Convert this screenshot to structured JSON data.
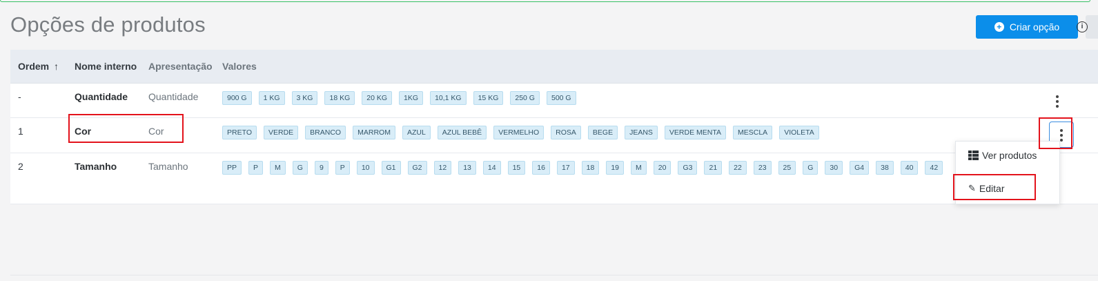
{
  "page": {
    "title": "Opções de produtos",
    "create_button": "Criar opção",
    "info_icon": "info-icon"
  },
  "table": {
    "columns": [
      "Ordem",
      "Nome interno",
      "Apresentação",
      "Valores"
    ],
    "sort_icon": "arrow-up-icon",
    "rows": [
      {
        "order": "-",
        "internal_name": "Quantidade",
        "presentation": "Quantidade",
        "values": [
          "900 G",
          "1 KG",
          "3 KG",
          "18 KG",
          "20 KG",
          "1KG",
          "10,1 KG",
          "15 KG",
          "250 G",
          "500 G"
        ]
      },
      {
        "order": "1",
        "internal_name": "Cor",
        "presentation": "Cor",
        "values": [
          "PRETO",
          "VERDE",
          "BRANCO",
          "MARROM",
          "AZUL",
          "AZUL BEBÊ",
          "VERMELHO",
          "ROSA",
          "BEGE",
          "JEANS",
          "VERDE MENTA",
          "MESCLA",
          "VIOLETA"
        ]
      },
      {
        "order": "2",
        "internal_name": "Tamanho",
        "presentation": "Tamanho",
        "values": [
          "PP",
          "P",
          "M",
          "G",
          "9",
          "P",
          "10",
          "G1",
          "G2",
          "12",
          "13",
          "14",
          "15",
          "16",
          "17",
          "18",
          "19",
          "M",
          "20",
          "G3",
          "21",
          "22",
          "23",
          "25",
          "G",
          "30",
          "G4",
          "38",
          "40",
          "42"
        ]
      }
    ]
  },
  "dropdown": {
    "view_products": "Ver produtos",
    "edit": "Editar"
  },
  "colors": {
    "primary": "#0b8eea",
    "highlight": "#e3121b",
    "chip_bg": "#d9edf8"
  }
}
